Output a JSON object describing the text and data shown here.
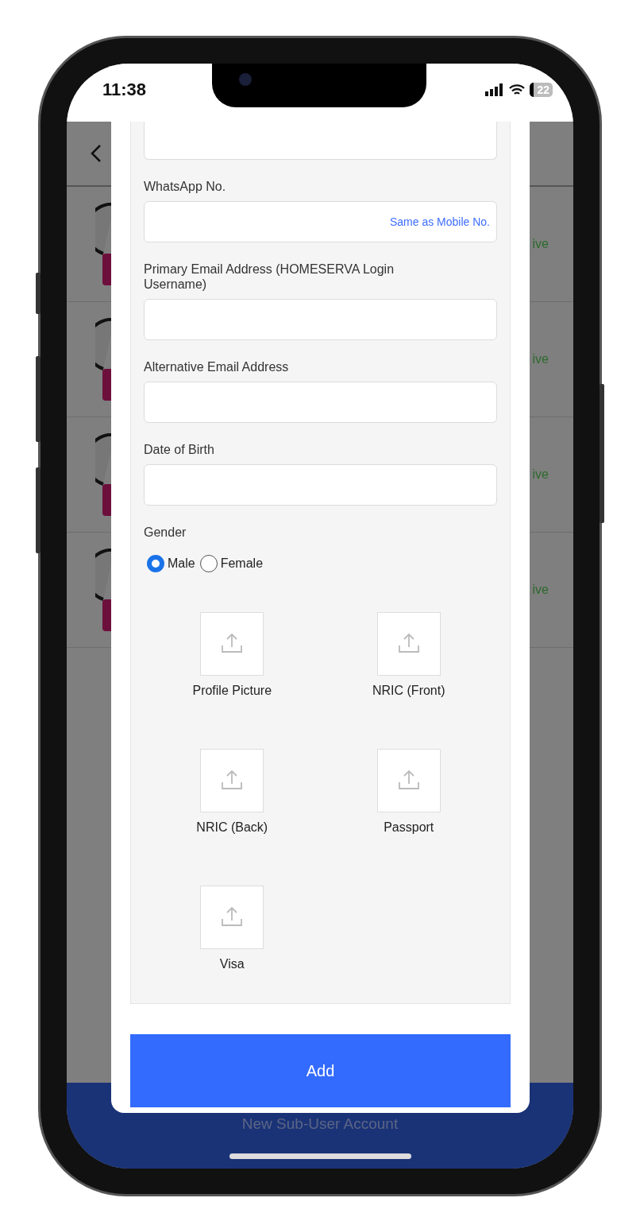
{
  "status_bar": {
    "time": "11:38",
    "battery": "22"
  },
  "background": {
    "rows": [
      {
        "status": "ive"
      },
      {
        "status": "ive"
      },
      {
        "status": "ive"
      },
      {
        "status": "ive"
      }
    ],
    "footer_button": "New Sub-User Account"
  },
  "form": {
    "fields": [
      {
        "kind": "text"
      },
      {
        "kind": "text",
        "label": "WhatsApp No.",
        "action": "Same as Mobile No."
      },
      {
        "kind": "text",
        "label": "Primary Email Address (HOMESERVA Login Username)"
      },
      {
        "kind": "text",
        "label": "Alternative Email Address"
      },
      {
        "kind": "text",
        "label": "Date of Birth"
      }
    ],
    "gender": {
      "label": "Gender",
      "options": [
        {
          "label": "Male",
          "selected": true
        },
        {
          "label": "Female",
          "selected": false
        }
      ]
    },
    "uploads": [
      {
        "label": "Profile Picture"
      },
      {
        "label": "NRIC (Front)"
      },
      {
        "label": "NRIC (Back)"
      },
      {
        "label": "Passport"
      },
      {
        "label": "Visa"
      }
    ],
    "submit": "Add"
  }
}
